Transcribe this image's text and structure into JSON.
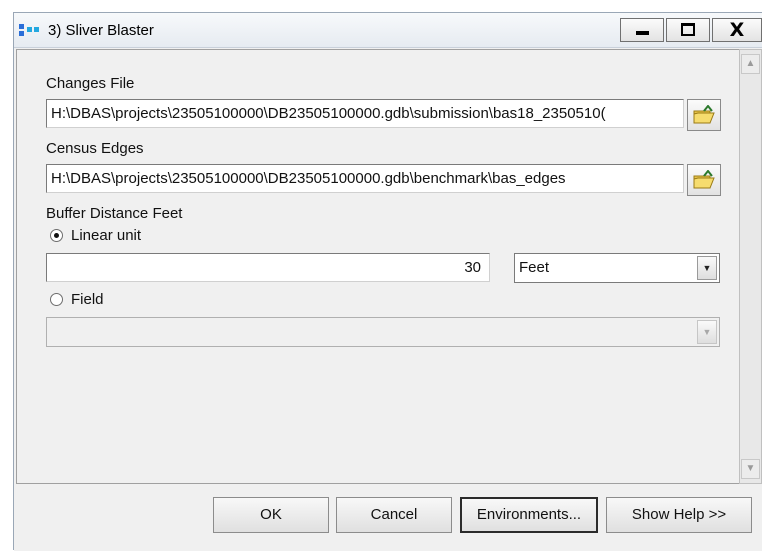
{
  "window": {
    "title": "3) Sliver Blaster",
    "controls": {
      "close_glyph": "X"
    }
  },
  "form": {
    "changes_file": {
      "label": "Changes File",
      "value": "H:\\DBAS\\projects\\23505100000\\DB23505100000.gdb\\submission\\bas18_2350510("
    },
    "census_edges": {
      "label": "Census Edges",
      "value": "H:\\DBAS\\projects\\23505100000\\DB23505100000.gdb\\benchmark\\bas_edges"
    },
    "buffer_distance": {
      "label": "Buffer Distance Feet",
      "linear_unit_label": "Linear unit",
      "linear_unit_selected": true,
      "distance_value": "30",
      "unit_selected": "Feet",
      "field_label": "Field",
      "field_value": ""
    }
  },
  "buttons": {
    "ok": "OK",
    "cancel": "Cancel",
    "environments": "Environments...",
    "show_help": "Show Help >>"
  },
  "icons": {
    "title": "arcgis-tool-icon",
    "browse": "open-folder-icon"
  }
}
